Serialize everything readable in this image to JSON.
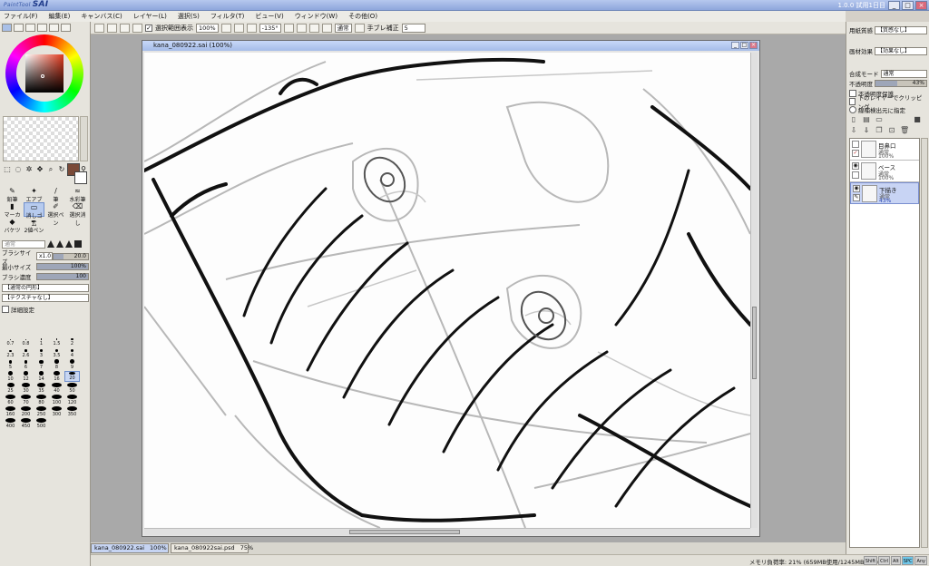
{
  "app": {
    "title_brand_small": "PaintTool",
    "title_brand": "SAI",
    "version": "1.0.0  試用1日目"
  },
  "menu": [
    "ファイル(F)",
    "編集(E)",
    "キャンバス(C)",
    "レイヤー(L)",
    "選択(S)",
    "フィルタ(T)",
    "ビュー(V)",
    "ウィンドウ(W)",
    "その他(O)"
  ],
  "toolbar": {
    "selection_label": "選択範囲表示",
    "zoom": "100%",
    "angle": "-135°",
    "blend": "通常",
    "stabilizer_label": "手ブレ補正",
    "stabilizer_value": "5"
  },
  "tools": [
    {
      "icon": "✎",
      "label": "鉛筆"
    },
    {
      "icon": "✦",
      "label": "エアブラシ"
    },
    {
      "icon": "/",
      "label": "筆"
    },
    {
      "icon": "≈",
      "label": "水彩筆"
    },
    {
      "icon": "▮",
      "label": "マーカー"
    },
    {
      "icon": "▭",
      "label": "消しゴム"
    },
    {
      "icon": "✐",
      "label": "選択ペン"
    },
    {
      "icon": "⌫",
      "label": "選択消し"
    },
    {
      "icon": "◆",
      "label": "バケツ"
    },
    {
      "icon": "✒",
      "label": "2値ペン"
    }
  ],
  "brush": {
    "shape_default": "通常",
    "size_label": "ブラシサイズ",
    "size_mult": "x1.0",
    "size_value": "20.0",
    "size_fill": 0.28,
    "min_label": "最小サイズ",
    "min_value": "100%",
    "min_fill": 1.0,
    "density_label": "ブラシ濃度",
    "density_value": "100",
    "density_fill": 1.0,
    "shape_drop": "【通常の円形】",
    "texture_drop": "【テクスチャなし】",
    "detail_label": "詳細設定"
  },
  "sizes": [
    "0.7",
    "0.8",
    "1",
    "1.5",
    "2",
    "2.3",
    "2.6",
    "3",
    "3.5",
    "4",
    "5",
    "6",
    "7",
    "8",
    "9",
    "10",
    "12",
    "14",
    "16",
    "20",
    "25",
    "30",
    "35",
    "40",
    "50",
    "60",
    "70",
    "80",
    "100",
    "120",
    "160",
    "200",
    "250",
    "300",
    "350",
    "400",
    "450",
    "500"
  ],
  "document": {
    "title": "kana_080922.sai (100%)"
  },
  "right": {
    "paper_label": "用紙質感",
    "paper_value": "【質感なし】",
    "effect_label": "画材効果",
    "effect_value": "【効果なし】",
    "blend_label": "合成モード",
    "blend_value": "通常",
    "opacity_label": "不透明度",
    "opacity_value": "43%",
    "opacity_fill": 0.43,
    "opt1": "不透明度保護",
    "opt2": "下のレイヤーでクリッピング",
    "opt3": "線補検出元に指定"
  },
  "layers": [
    {
      "name": "目鼻口",
      "mode": "通常",
      "opacity": "100%",
      "eye": "",
      "pen": "✓",
      "selected": false
    },
    {
      "name": "ベース",
      "mode": "通常",
      "opacity": "100%",
      "eye": "◉",
      "pen": "",
      "selected": false
    },
    {
      "name": "下描き",
      "mode": "通常",
      "opacity": "43%",
      "eye": "◉",
      "pen": "✎",
      "selected": true
    }
  ],
  "tabs": [
    {
      "name": "kana_080922.sai",
      "zoom": "100%",
      "active": true
    },
    {
      "name": "kana_080922sai.psd",
      "zoom": "75%",
      "active": false
    }
  ],
  "status": {
    "memory": "メモリ負荷率: 21% (659MB使用/1245MB確保)",
    "keys": [
      "Shift",
      "Ctrl",
      "Alt",
      "SPC",
      "Any"
    ]
  }
}
